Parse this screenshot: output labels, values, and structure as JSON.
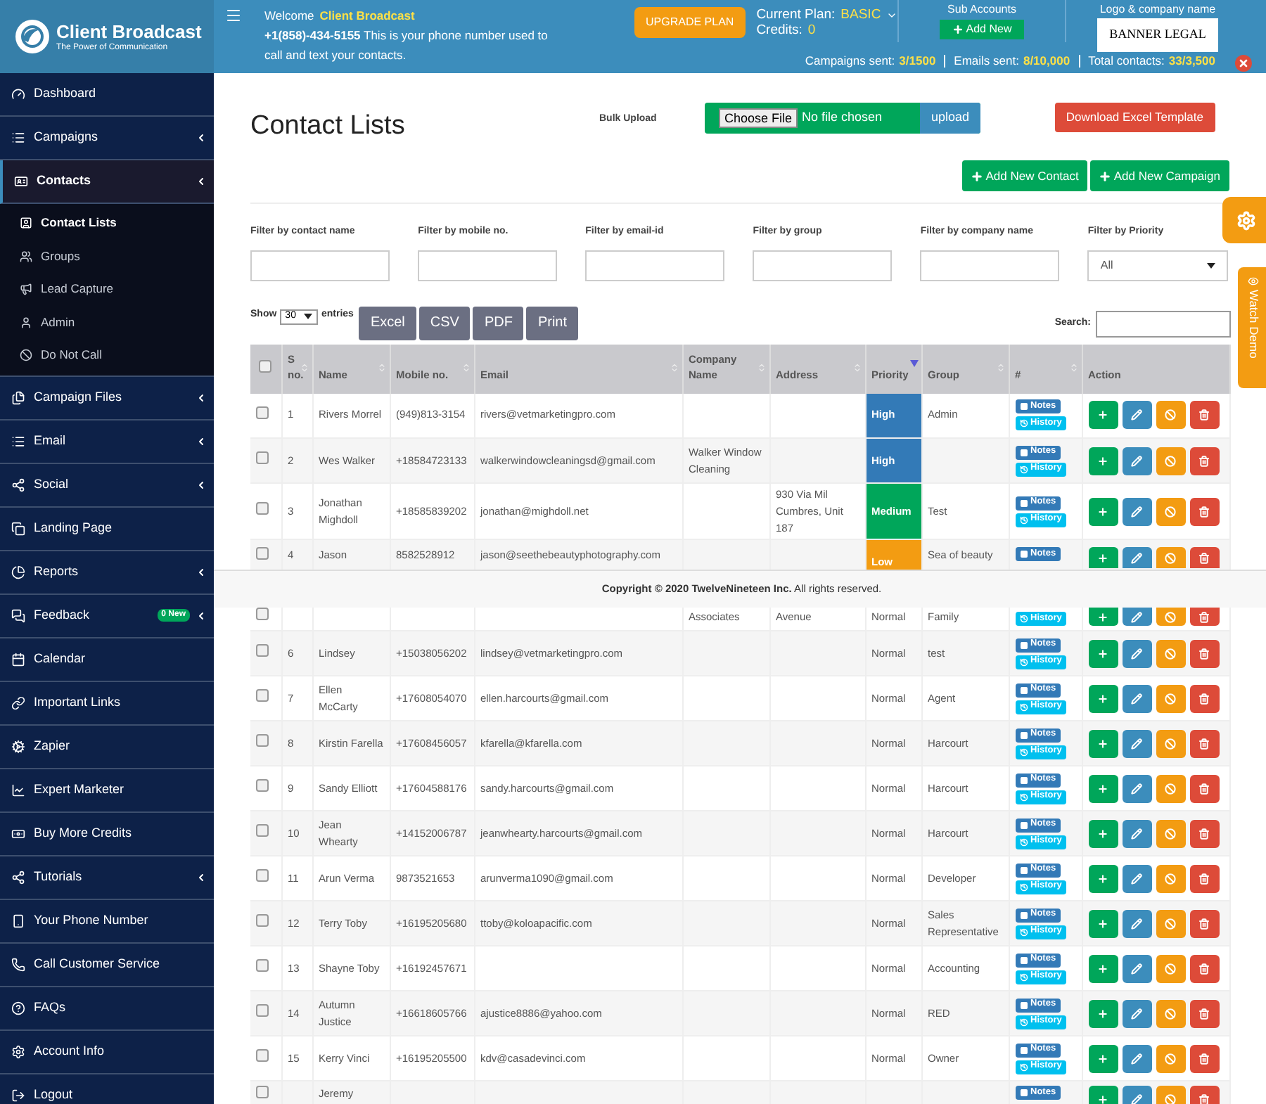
{
  "header": {
    "brand_name": "Client Broadcast",
    "brand_tagline": "The Power of Communication",
    "welcome_prefix": "Welcome",
    "welcome_name": "Client Broadcast",
    "phone": "+1(858)-434-5155",
    "phone_note": "This is your phone number used to call and text your contacts.",
    "upgrade": "UPGRADE PLAN",
    "plan_label": "Current Plan:",
    "plan": "BASIC",
    "credits_label": "Credits:",
    "credits": "0",
    "stats": [
      {
        "label": "Campaigns sent:",
        "value": "3/1500"
      },
      {
        "label": "Emails sent:",
        "value": "8/10,000"
      },
      {
        "label": "Total contacts:",
        "value": "33/3,500"
      }
    ],
    "sub_accounts_title": "Sub Accounts",
    "add_new": "Add New",
    "logo_title": "Logo & company name",
    "logo_text": "BANNER LEGAL"
  },
  "sidebar": {
    "items": [
      {
        "label": "Dashboard",
        "expandable": false,
        "selected": false
      },
      {
        "label": "Campaigns",
        "expandable": true,
        "selected": false
      },
      {
        "label": "Contacts",
        "expandable": true,
        "selected": true,
        "expanded": true,
        "children": [
          {
            "label": "Contact Lists",
            "selected": true
          },
          {
            "label": "Groups",
            "selected": false
          },
          {
            "label": "Lead Capture",
            "selected": false
          },
          {
            "label": "Admin",
            "selected": false
          },
          {
            "label": "Do Not Call",
            "selected": false
          }
        ]
      },
      {
        "label": "Campaign Files",
        "expandable": true,
        "selected": false
      },
      {
        "label": "Email",
        "expandable": true,
        "selected": false
      },
      {
        "label": "Social",
        "expandable": true,
        "selected": false
      },
      {
        "label": "Landing Page",
        "expandable": false,
        "selected": false
      },
      {
        "label": "Reports",
        "expandable": true,
        "selected": false
      },
      {
        "label": "Feedback",
        "expandable": true,
        "selected": false,
        "badge": "0 New"
      },
      {
        "label": "Calendar",
        "expandable": false,
        "selected": false
      },
      {
        "label": "Important Links",
        "expandable": false,
        "selected": false
      },
      {
        "label": "Zapier",
        "expandable": false,
        "selected": false
      },
      {
        "label": "Expert Marketer",
        "expandable": false,
        "selected": false
      },
      {
        "label": "Buy More Credits",
        "expandable": false,
        "selected": false
      },
      {
        "label": "Tutorials",
        "expandable": true,
        "selected": false
      },
      {
        "label": "Your Phone Number",
        "expandable": false,
        "selected": false
      },
      {
        "label": "Call Customer Service",
        "expandable": false,
        "selected": false
      },
      {
        "label": "FAQs",
        "expandable": false,
        "selected": false
      },
      {
        "label": "Account Info",
        "expandable": false,
        "selected": false
      },
      {
        "label": "Logout",
        "expandable": false,
        "selected": false
      }
    ]
  },
  "page": {
    "title": "Contact Lists",
    "bulk_upload_label": "Bulk Upload",
    "choose_file": "Choose File",
    "no_file": "No file chosen",
    "upload": "upload",
    "download_template": "Download Excel Template",
    "add_contact": "Add New Contact",
    "add_campaign": "Add New Campaign"
  },
  "filters": [
    {
      "label": "Filter by contact name",
      "kind": "text"
    },
    {
      "label": "Filter by mobile no.",
      "kind": "text"
    },
    {
      "label": "Filter by email-id",
      "kind": "text"
    },
    {
      "label": "Filter by group",
      "kind": "text"
    },
    {
      "label": "Filter by company name",
      "kind": "text"
    },
    {
      "label": "Filter by Priority",
      "kind": "select",
      "value": "All"
    }
  ],
  "toolbar": {
    "show": "Show",
    "entries_value": "30",
    "entries": "entries",
    "export_buttons": [
      "Excel",
      "CSV",
      "PDF",
      "Print"
    ],
    "search_label": "Search:"
  },
  "table": {
    "columns": [
      {
        "label": "S no.",
        "sorted": false
      },
      {
        "label": "Name",
        "sorted": false
      },
      {
        "label": "Mobile no.",
        "sorted": false
      },
      {
        "label": "Email",
        "sorted": false
      },
      {
        "label": "Company Name",
        "sorted": false
      },
      {
        "label": "Address",
        "sorted": false
      },
      {
        "label": "Priority",
        "sorted": true
      },
      {
        "label": "Group",
        "sorted": false
      },
      {
        "label": "#",
        "sorted": false
      },
      {
        "label": "Action"
      }
    ],
    "all_checked": false,
    "rows": [
      {
        "s_no": "1",
        "name": "Rivers Morrel",
        "mobile": "(949)813-3154",
        "email": "rivers@vetmarketingpro.com",
        "priority": "High",
        "color": "#337ab7",
        "group": "Admin",
        "notes": "Notes",
        "history": "History",
        "checked": false
      },
      {
        "s_no": "2",
        "name": "Wes Walker",
        "mobile": "+18584723133",
        "email": "walkerwindowcleaningsd@gmail.com",
        "company": "Walker Window Cleaning",
        "priority": "High",
        "color": "#337ab7",
        "notes": "Notes",
        "history": "History",
        "checked": false
      },
      {
        "s_no": "3",
        "name": "Jonathan Mighdoll",
        "mobile": "+18585839202",
        "email": "jonathan@mighdoll.net",
        "address": "930 Via Mil Cumbres, Unit 187",
        "priority": "Medium",
        "color": "#00a65a",
        "group": "Test",
        "notes": "Notes",
        "history": "History",
        "checked": false
      },
      {
        "s_no": "4",
        "name": "Jason",
        "mobile": "8582528912",
        "email": "jason@seethebeautyphotography.com",
        "priority": "Low",
        "color": "#f39c12",
        "group": "Sea of beauty",
        "notes": "Notes",
        "checked": false
      },
      {
        "company": "Associates",
        "address": "Avenue",
        "priority": "Normal",
        "group": "Family",
        "history": "History",
        "checked": false
      },
      {
        "s_no": "6",
        "name": "Lindsey",
        "mobile": "+15038056202",
        "email": "lindsey@vetmarketingpro.com",
        "priority": "Normal",
        "group": "test",
        "notes": "Notes",
        "history": "History",
        "checked": false
      },
      {
        "s_no": "7",
        "name": "Ellen McCarty",
        "mobile": "+17608054070",
        "email": "ellen.harcourts@gmail.com",
        "priority": "Normal",
        "group": "Agent",
        "notes": "Notes",
        "history": "History",
        "checked": false
      },
      {
        "s_no": "8",
        "name": "Kirstin Farella",
        "mobile": "+17608456057",
        "email": "kfarella@kfarella.com",
        "priority": "Normal",
        "group": "Harcourt",
        "notes": "Notes",
        "history": "History",
        "checked": false
      },
      {
        "s_no": "9",
        "name": "Sandy Elliott",
        "mobile": "+17604588176",
        "email": "sandy.harcourts@gmail.com",
        "priority": "Normal",
        "group": "Harcourt",
        "notes": "Notes",
        "history": "History",
        "checked": false
      },
      {
        "s_no": "10",
        "name": "Jean Whearty",
        "mobile": "+14152006787",
        "email": "jeanwhearty.harcourts@gmail.com",
        "priority": "Normal",
        "group": "Harcourt",
        "notes": "Notes",
        "history": "History",
        "checked": false
      },
      {
        "s_no": "11",
        "name": "Arun Verma",
        "mobile": "9873521653",
        "email": "arunverma1090@gmail.com",
        "priority": "Normal",
        "group": "Developer",
        "notes": "Notes",
        "history": "History",
        "checked": false
      },
      {
        "s_no": "12",
        "name": "Terry Toby",
        "mobile": "+16195205680",
        "email": "ttoby@koloapacific.com",
        "priority": "Normal",
        "group": "Sales Representative",
        "notes": "Notes",
        "history": "History",
        "checked": false
      },
      {
        "s_no": "13",
        "name": "Shayne Toby",
        "mobile": "+16192457671",
        "priority": "Normal",
        "group": "Accounting",
        "notes": "Notes",
        "history": "History",
        "checked": false
      },
      {
        "s_no": "14",
        "name": "Autumn Justice",
        "mobile": "+16618605766",
        "email": "ajustice8886@yahoo.com",
        "priority": "Normal",
        "group": "RED",
        "notes": "Notes",
        "history": "History",
        "checked": false
      },
      {
        "s_no": "15",
        "name": "Kerry Vinci",
        "mobile": "+16195205500",
        "email": "kdv@casadevinci.com",
        "priority": "Normal",
        "group": "Owner",
        "notes": "Notes",
        "history": "History",
        "checked": false
      },
      {
        "name": "Jeremy",
        "notes": "Notes",
        "checked": false
      }
    ]
  },
  "footer": {
    "text": "**Copyright © 2020 TwelveNineteen Inc.** All rights reserved."
  },
  "side_tabs": {
    "watch_demo": "Watch Demo"
  }
}
